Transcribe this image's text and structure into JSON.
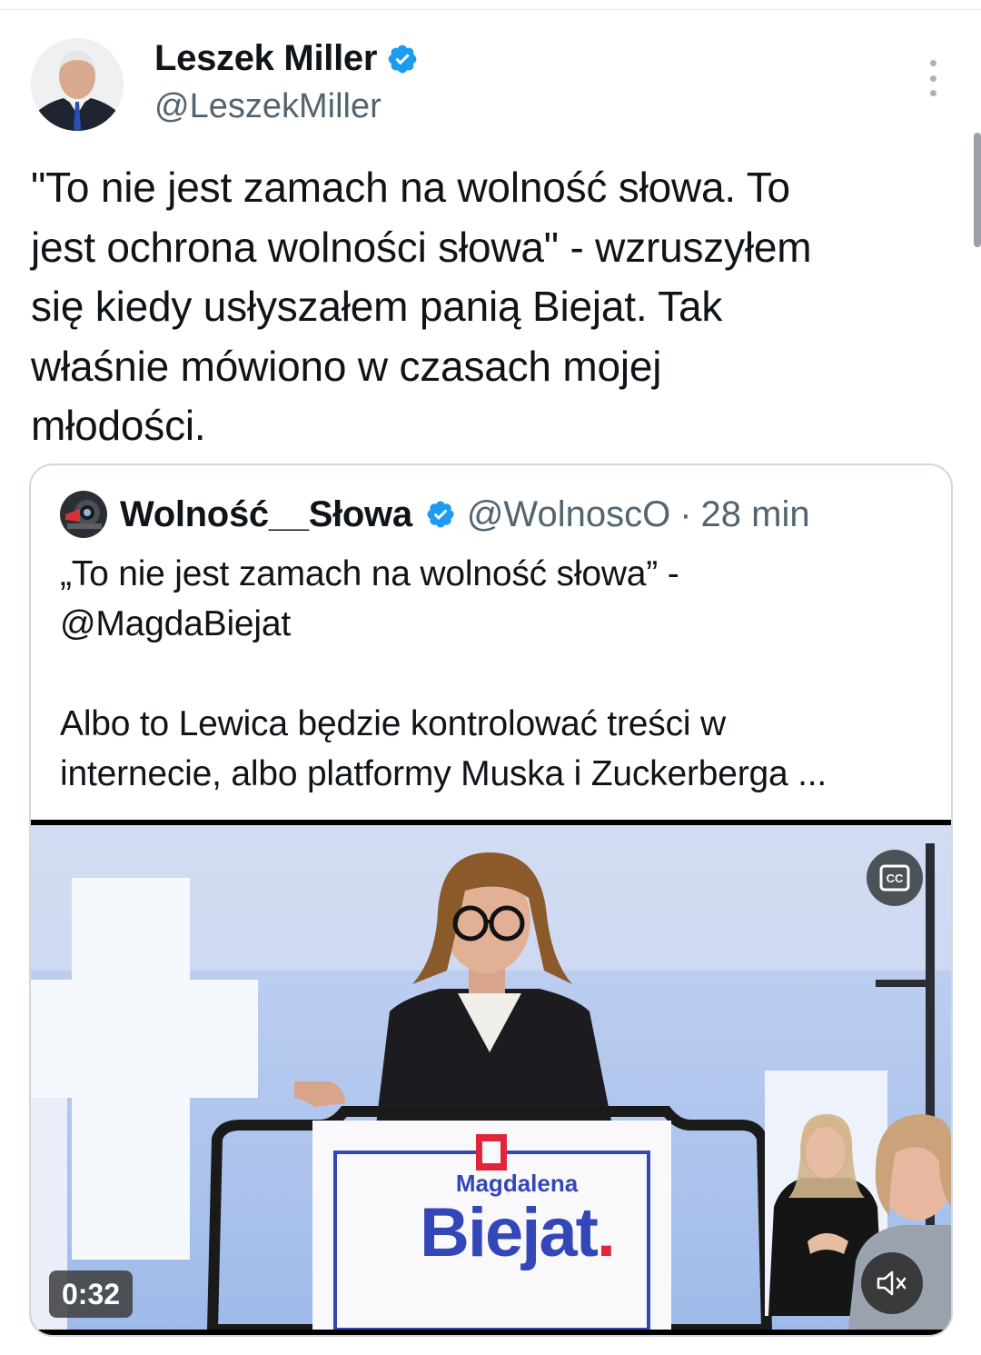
{
  "author": {
    "name": "Leszek Miller",
    "handle": "@LeszekMiller",
    "verified": true
  },
  "tweet": {
    "text": "\"To nie jest zamach na wolność słowa. To\njest ochrona wolności słowa\" - wzruszyłem\nsię kiedy usłyszałem panią Biejat. Tak\nwłaśnie mówiono w czasach mojej\nmłodości."
  },
  "quote": {
    "name": "Wolność__Słowa",
    "handle": "@WolnoscO",
    "separator": "·",
    "time": "28 min",
    "text": "„To nie jest zamach na wolność słowa” -\n@MagdaBiejat\n\nAlbo to Lewica będzie kontrolować treści w\ninternecie, albo platformy Muska i Zuckerberga ...",
    "video": {
      "duration": "0:32",
      "podium_first_name": "Magdalena",
      "podium_last_name": "Biejat",
      "podium_dot": ".",
      "cc_label": "CC"
    }
  },
  "icons": {
    "verified": "verified-badge-icon",
    "more": "more-options-icon",
    "cc": "closed-captions-icon",
    "mute": "muted-speaker-icon"
  },
  "colors": {
    "verified_blue": "#1d9bf0",
    "secondary_text": "#536471",
    "podium_blue": "#3447b8",
    "podium_red": "#e0243a"
  }
}
